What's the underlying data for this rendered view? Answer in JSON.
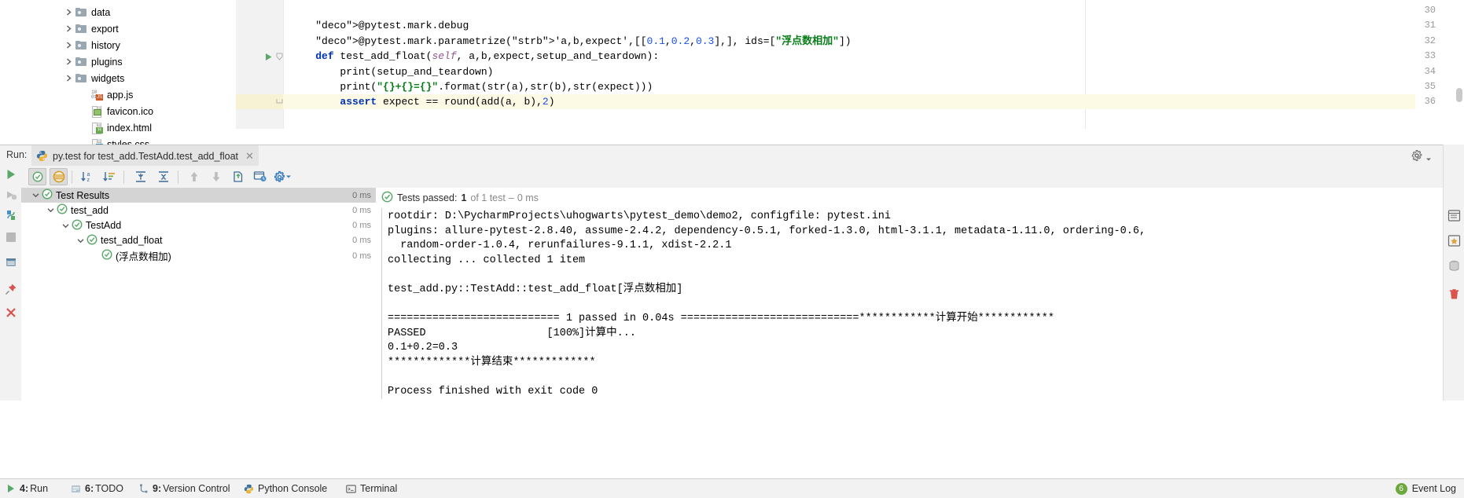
{
  "project_tree": [
    {
      "label": "data",
      "type": "folder",
      "indent": 0
    },
    {
      "label": "export",
      "type": "folder",
      "indent": 0
    },
    {
      "label": "history",
      "type": "folder",
      "indent": 0
    },
    {
      "label": "plugins",
      "type": "folder",
      "indent": 0
    },
    {
      "label": "widgets",
      "type": "folder",
      "indent": 0
    },
    {
      "label": "app.js",
      "type": "js",
      "indent": 0
    },
    {
      "label": "favicon.ico",
      "type": "ico",
      "indent": 0
    },
    {
      "label": "index.html",
      "type": "html",
      "indent": 0
    },
    {
      "label": "styles.css",
      "type": "css",
      "indent": 0
    }
  ],
  "editor": {
    "lines": [
      {
        "num": "30",
        "text": ""
      },
      {
        "num": "31",
        "text": "    @pytest.mark.debug"
      },
      {
        "num": "32",
        "text": "    @pytest.mark.parametrize('a,b,expect',[[0.1,0.2,0.3],], ids=[\"浮点数相加\"])"
      },
      {
        "num": "33",
        "text": "    def test_add_float(self, a,b,expect,setup_and_teardown):"
      },
      {
        "num": "34",
        "text": "        print(setup_and_teardown)"
      },
      {
        "num": "35",
        "text": "        print(\"{}+{}={}\".format(str(a),str(b),str(expect)))"
      },
      {
        "num": "36",
        "text": "        assert expect == round(add(a, b),2)"
      }
    ],
    "highlighted_line": "36",
    "run_marker_line": "33"
  },
  "run_window": {
    "run_label": "Run:",
    "tab_title": "py.test for test_add.TestAdd.test_add_float",
    "tab_close": "✕",
    "toolbar_left": [
      {
        "name": "rerun-button",
        "icon": "play-green"
      },
      {
        "name": "rerun-failed-button",
        "icon": "rerun-failed"
      },
      {
        "name": "toggle-auto-test-button",
        "icon": "auto-test"
      },
      {
        "name": "stop-button",
        "icon": "stop-square"
      },
      {
        "name": "export-test-results-button",
        "icon": "export"
      },
      {
        "name": "pin-tab-button",
        "icon": "pin"
      },
      {
        "name": "close-button",
        "icon": "close-x"
      }
    ],
    "toolbar_top": [
      {
        "name": "show-passed-button",
        "icon": "check-circle",
        "toggled": true
      },
      {
        "name": "show-ignored-button",
        "icon": "ignored",
        "toggled": true
      },
      {
        "name": "sort-alphabetically-button",
        "icon": "sort-az"
      },
      {
        "name": "sort-by-duration-button",
        "icon": "sort-duration"
      },
      {
        "name": "expand-all-button",
        "icon": "expand-all"
      },
      {
        "name": "collapse-all-button",
        "icon": "collapse-all"
      },
      {
        "name": "previous-failed-button",
        "icon": "arrow-up"
      },
      {
        "name": "next-failed-button",
        "icon": "arrow-down"
      },
      {
        "name": "export-results-button",
        "icon": "export-doc"
      },
      {
        "name": "open-in-browser-button",
        "icon": "browser"
      },
      {
        "name": "settings-button",
        "icon": "gear-blue"
      }
    ],
    "settings_icon": "gear-icon",
    "minimize_icon": "minimize-icon"
  },
  "test_tree": {
    "rows": [
      {
        "label": "Test Results",
        "duration": "0 ms",
        "indent": 0,
        "selected": true,
        "expanded": true
      },
      {
        "label": "test_add",
        "duration": "0 ms",
        "indent": 1,
        "selected": false,
        "expanded": true
      },
      {
        "label": "TestAdd",
        "duration": "0 ms",
        "indent": 2,
        "selected": false,
        "expanded": true
      },
      {
        "label": "test_add_float",
        "duration": "0 ms",
        "indent": 3,
        "selected": false,
        "expanded": true
      },
      {
        "label": "(浮点数相加)",
        "duration": "0 ms",
        "indent": 4,
        "selected": false,
        "expanded": false
      }
    ]
  },
  "status": {
    "prefix": "Tests passed:",
    "count": "1",
    "of_text": "of 1 test",
    "dash": "–",
    "time": "0 ms"
  },
  "console": {
    "lines": [
      "rootdir: D:\\PycharmProjects\\uhogwarts\\pytest_demo\\demo2, configfile: pytest.ini",
      "plugins: allure-pytest-2.8.40, assume-2.4.2, dependency-0.5.1, forked-1.3.0, html-3.1.1, metadata-1.11.0, ordering-0.6,",
      "  random-order-1.0.4, rerunfailures-9.1.1, xdist-2.2.1",
      "collecting ... collected 1 item",
      "",
      "test_add.py::TestAdd::test_add_float[浮点数相加]",
      "",
      "=========================== 1 passed in 0.04s ============================************计算开始************",
      "PASSED                   [100%]计算中...",
      "0.1+0.2=0.3",
      "*************计算结束*************",
      "",
      "Process finished with exit code 0"
    ]
  },
  "right_strip": [
    {
      "name": "structure-button",
      "icon": "structure"
    },
    {
      "name": "favorites-button",
      "icon": "favorites"
    },
    {
      "name": "database-button",
      "icon": "database"
    },
    {
      "name": "delete-button",
      "icon": "trash"
    }
  ],
  "status_bar": {
    "items": [
      {
        "num": "4:",
        "label": "Run",
        "icon": "play-green-small"
      },
      {
        "num": "6:",
        "label": "TODO",
        "icon": "todo"
      },
      {
        "num": "9:",
        "label": "Version Control",
        "icon": "vcs"
      },
      {
        "num": "",
        "label": "Python Console",
        "icon": "python"
      },
      {
        "num": "",
        "label": "Terminal",
        "icon": "terminal"
      }
    ],
    "event_log": {
      "count": "6",
      "label": "Event Log"
    }
  },
  "colors": {
    "accent_green": "#59a869",
    "toolbar_bg": "#f2f2f2",
    "selection": "#d4d4d4",
    "highlight_line": "#fcf9e4"
  }
}
